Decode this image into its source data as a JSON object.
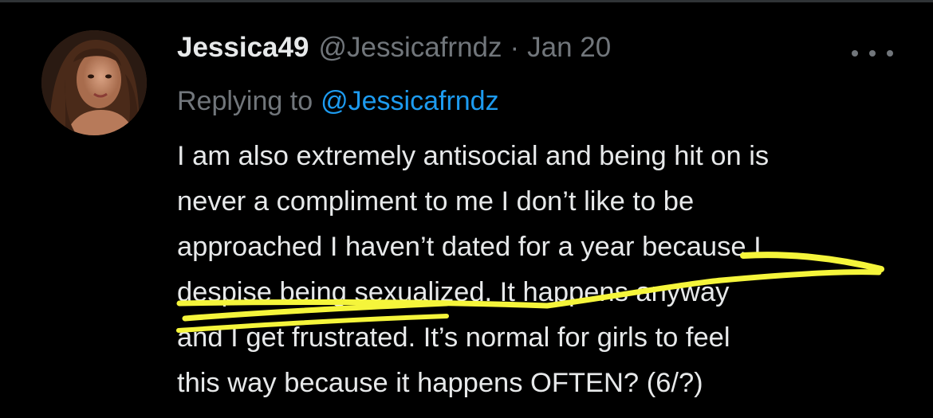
{
  "tweet": {
    "author": {
      "display_name": "Jessica49",
      "handle": "@Jessicafrndz",
      "avatar": "profile-photo"
    },
    "separator": "·",
    "timestamp": "Jan 20",
    "more_icon": "ellipsis-icon",
    "reply": {
      "prefix": "Replying to",
      "mention": "@Jessicafrndz"
    },
    "body_lines": [
      "I am also extremely antisocial and being hit on is",
      "never a compliment to me I don’t like to be",
      "approached I haven’t dated for a year because I",
      "despise being sexualized. It happens anyway",
      "and I get frustrated. It’s normal for girls to feel",
      "this way because it happens OFTEN? (6/?)"
    ]
  },
  "colors": {
    "background": "#000000",
    "text_primary": "#e7e9ea",
    "text_secondary": "#71767b",
    "link": "#1d9bf0",
    "highlight": "#f5f53b",
    "top_border": "#2f3336"
  }
}
